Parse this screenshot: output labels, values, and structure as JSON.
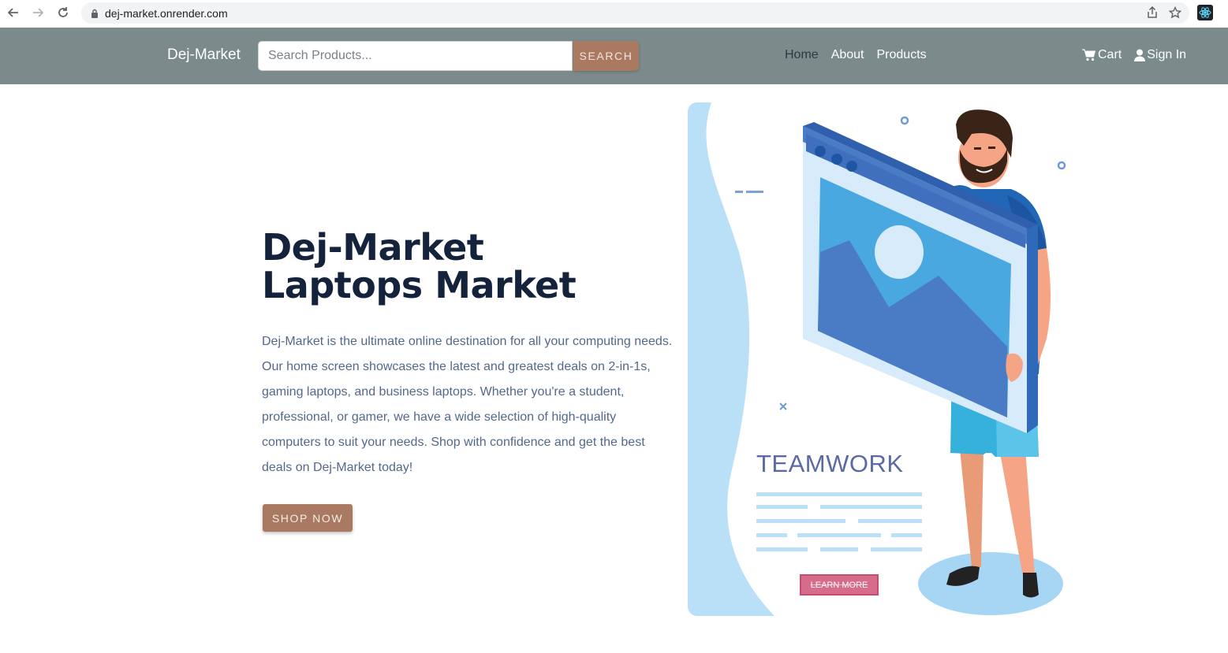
{
  "browser": {
    "url": "dej-market.onrender.com"
  },
  "navbar": {
    "brand": "Dej-Market",
    "search_placeholder": "Search Products...",
    "search_label": "SEARCH",
    "links": [
      {
        "label": "Home",
        "active": true
      },
      {
        "label": "About",
        "active": false
      },
      {
        "label": "Products",
        "active": false
      }
    ],
    "cart_label": "Cart",
    "signin_label": "Sign In",
    "icons": [
      "cart-icon",
      "user-icon"
    ]
  },
  "hero": {
    "title_line1": "Dej-Market",
    "title_line2": "Laptops Market",
    "description": "Dej-Market is the ultimate online destination for all your computing needs. Our home screen showcases the latest and greatest deals on 2-in-1s, gaming laptops, and business laptops. Whether you're a student, professional, or gamer, we have a wide selection of high-quality computers to suit your needs. Shop with confidence and get the best deals on Dej-Market today!",
    "cta_label": "SHOP NOW"
  },
  "illustration": {
    "heading": "TEAMWORK",
    "button_label": "LEARN MORE"
  },
  "colors": {
    "navbar_bg": "#7b8a8a",
    "accent": "#a97a61",
    "title": "#14233b",
    "body_text": "#53688a"
  }
}
